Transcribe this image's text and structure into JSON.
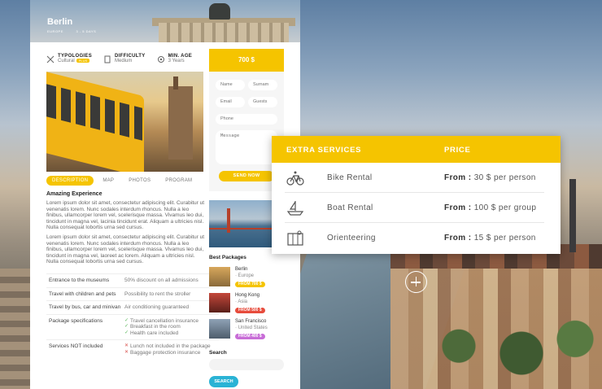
{
  "hero": {
    "title": "Berlin",
    "region": "EUROPE",
    "duration": "3 - 5 DAYS"
  },
  "meta": [
    {
      "label": "TYPOLOGIES",
      "value": "Cultural",
      "tag": "PLUS"
    },
    {
      "label": "DIFFICULTY",
      "value": "Medium"
    },
    {
      "label": "MIN. AGE",
      "value": "3 Years"
    }
  ],
  "tabs": [
    "DESCRIPTION",
    "MAP",
    "PHOTOS",
    "PROGRAM"
  ],
  "description": {
    "heading": "Amazing Experience",
    "para1": "Lorem ipsum dolor sit amet, consectetur adipiscing elit. Curabitur ut venenatis lorem. Nunc sodales interdum rhoncus. Nulla a leo finibus, ullamcorper lorem vel, scelerisque massa. Vivamus leo dui, tincidunt in magna vel, lacinia tincidunt erat. Aliquam a ultricies nisl. Nulla consequat lobortis urna sed cursus.",
    "para2": "Lorem ipsum dolor sit amet, consectetur adipiscing elit. Curabitur ut venenatis lorem. Nunc sodales interdum rhoncus. Nulla a leo finibus, ullamcorper lorem vel, scelerisque massa. Vivamus leo dui, tincidunt in magna vel, laoreet ac lorem. Aliquam a ultricies nisl. Nulla consequat lobortis urna sed cursus."
  },
  "specs": [
    {
      "key": "Entrance to the museums",
      "values": [
        {
          "text": "50% discount on all admissions",
          "kind": "plain"
        }
      ]
    },
    {
      "key": "Travel with children and pets",
      "values": [
        {
          "text": "Possibility to rent the stroller",
          "kind": "plain"
        }
      ]
    },
    {
      "key": "Travel by bus, car and minivan",
      "values": [
        {
          "text": "Air conditioning guaranteed",
          "kind": "plain"
        }
      ]
    },
    {
      "key": "Package specifications",
      "values": [
        {
          "text": "Travel cancellation insurance",
          "kind": "ok"
        },
        {
          "text": "Breakfast in the room",
          "kind": "ok"
        },
        {
          "text": "Health care included",
          "kind": "ok"
        }
      ]
    },
    {
      "key": "Services NOT included",
      "values": [
        {
          "text": "Lunch not included in the package",
          "kind": "no"
        },
        {
          "text": "Baggage protection insurance",
          "kind": "no"
        }
      ]
    }
  ],
  "booking": {
    "price": "700 $",
    "name_placeholder": "Name",
    "surname_placeholder": "Surnam",
    "email_placeholder": "Email",
    "guests_placeholder": "Guests",
    "phone_placeholder": "Phone",
    "message_placeholder": "Message",
    "send_label": "SEND NOW"
  },
  "best_packages": {
    "title": "Best Packages",
    "items": [
      {
        "city": "Berlin",
        "country": "Europe",
        "price": "FROM 700 $",
        "color": "#f5c400"
      },
      {
        "city": "Hong Kong",
        "country": "Asia",
        "price": "FROM 500 $",
        "color": "#e74c3c"
      },
      {
        "city": "San Francisco",
        "country": "United States",
        "price": "FROM 400 $",
        "color": "#c86dd7"
      }
    ]
  },
  "search": {
    "title": "Search",
    "button": "SEARCH"
  },
  "extra_services": {
    "col1": "EXTRA SERVICES",
    "col2": "PRICE",
    "rows": [
      {
        "icon": "bike-icon",
        "name": "Bike Rental",
        "from": "From :",
        "price": "30 $ per person"
      },
      {
        "icon": "boat-icon",
        "name": "Boat Rental",
        "from": "From :",
        "price": "100 $ per group"
      },
      {
        "icon": "map-icon",
        "name": "Orienteering",
        "from": "From :",
        "price": "15 $ per person"
      }
    ]
  },
  "colors": {
    "accent": "#f5c400",
    "search": "#2ab3d5"
  }
}
